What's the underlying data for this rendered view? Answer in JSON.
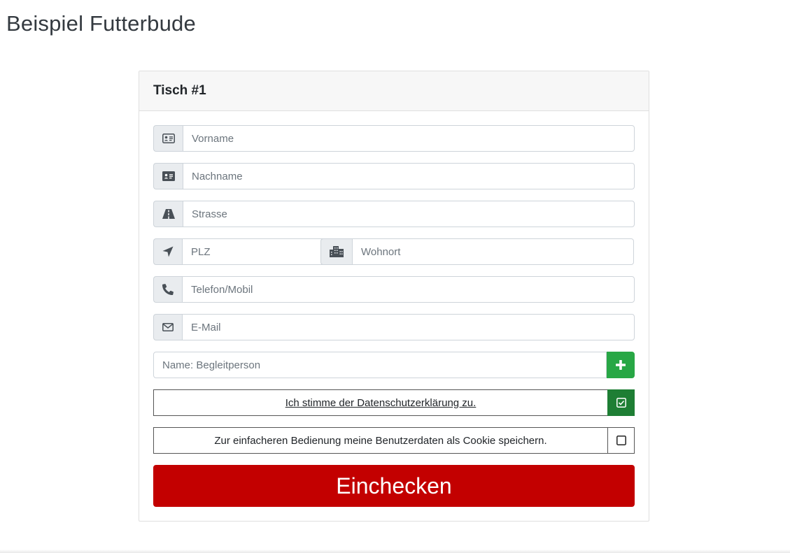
{
  "app": {
    "title": "Beispiel Futterbude"
  },
  "card": {
    "title": "Tisch #1"
  },
  "form": {
    "vorname": {
      "placeholder": "Vorname",
      "value": "",
      "icon": "id-card-outline-icon"
    },
    "nachname": {
      "placeholder": "Nachname",
      "value": "",
      "icon": "id-card-icon"
    },
    "strasse": {
      "placeholder": "Strasse",
      "value": "",
      "icon": "road-icon"
    },
    "plz": {
      "placeholder": "PLZ",
      "value": "",
      "icon": "location-arrow-icon"
    },
    "wohnort": {
      "placeholder": "Wohnort",
      "value": "",
      "icon": "city-icon"
    },
    "telefon": {
      "placeholder": "Telefon/Mobil",
      "value": "",
      "icon": "phone-icon"
    },
    "email": {
      "placeholder": "E-Mail",
      "value": "",
      "icon": "envelope-icon"
    },
    "begleitperson": {
      "placeholder": "Name: Begleitperson",
      "value": "",
      "add_icon": "plus-icon"
    }
  },
  "consents": {
    "privacy": {
      "label": "Ich stimme der Datenschutzerklärung zu.",
      "checked": true,
      "icon": "checkbox-checked-icon"
    },
    "cookie": {
      "label": "Zur einfacheren Bedienung meine Benutzerdaten als Cookie speichern.",
      "checked": false,
      "icon": "checkbox-empty-icon"
    }
  },
  "submit": {
    "label": "Einchecken"
  },
  "colors": {
    "submit_bg": "#c30000",
    "add_button": "#28a745",
    "checked_box": "#1e7e34"
  }
}
